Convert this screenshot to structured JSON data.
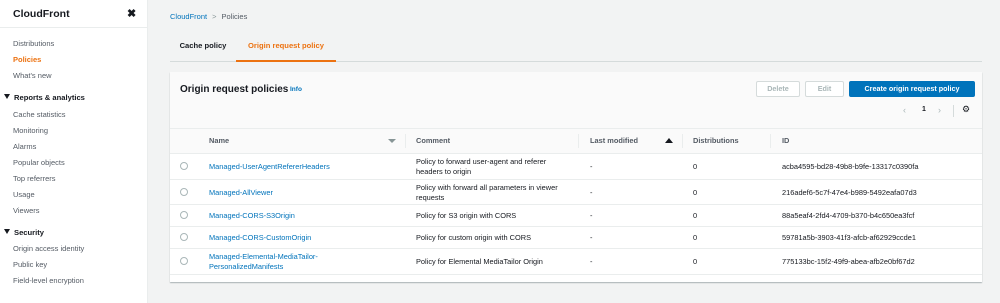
{
  "sidebar": {
    "title": "CloudFront",
    "close_glyph": "✖",
    "items": [
      {
        "label": "Distributions"
      },
      {
        "label": "Policies"
      },
      {
        "label": "What's new"
      }
    ],
    "sections": [
      {
        "label": "Reports & analytics",
        "items": [
          {
            "label": "Cache statistics"
          },
          {
            "label": "Monitoring"
          },
          {
            "label": "Alarms"
          },
          {
            "label": "Popular objects"
          },
          {
            "label": "Top referrers"
          },
          {
            "label": "Usage"
          },
          {
            "label": "Viewers"
          }
        ]
      },
      {
        "label": "Security",
        "items": [
          {
            "label": "Origin access identity"
          },
          {
            "label": "Public key"
          },
          {
            "label": "Field-level encryption"
          }
        ]
      }
    ]
  },
  "breadcrumb": {
    "root": "CloudFront",
    "separator": ">",
    "current": "Policies"
  },
  "tabs": [
    {
      "label": "Cache policy"
    },
    {
      "label": "Origin request policy"
    }
  ],
  "panel": {
    "title": "Origin request policies",
    "info": "Info",
    "delete_label": "Delete",
    "edit_label": "Edit",
    "create_label": "Create origin request policy",
    "pager": {
      "prev": "‹",
      "page": "1",
      "next": "›",
      "settings_glyph": "⚙"
    }
  },
  "table": {
    "columns": [
      "Name",
      "Comment",
      "Last modified",
      "Distributions",
      "ID"
    ],
    "rows": [
      {
        "name": [
          "Managed-UserAgentRefererHeaders"
        ],
        "comment": [
          "Policy to forward user-agent and referer",
          "headers to origin"
        ],
        "modified": "-",
        "distributions": "0",
        "id": "acba4595-bd28-49b8-b9fe-13317c0390fa"
      },
      {
        "name": [
          "Managed-AllViewer"
        ],
        "comment": [
          "Policy with forward all parameters in viewer",
          "requests"
        ],
        "modified": "-",
        "distributions": "0",
        "id": "216adef6-5c7f-47e4-b989-5492eafa07d3"
      },
      {
        "name": [
          "Managed-CORS-S3Origin"
        ],
        "comment": [
          "Policy for S3 origin with CORS"
        ],
        "modified": "-",
        "distributions": "0",
        "id": "88a5eaf4-2fd4-4709-b370-b4c650ea3fcf"
      },
      {
        "name": [
          "Managed-CORS-CustomOrigin"
        ],
        "comment": [
          "Policy for custom origin with CORS"
        ],
        "modified": "-",
        "distributions": "0",
        "id": "59781a5b-3903-41f3-afcb-af62929ccde1"
      },
      {
        "name": [
          "Managed-Elemental-MediaTailor-",
          "PersonalizedManifests"
        ],
        "comment": [
          "Policy for Elemental MediaTailor Origin"
        ],
        "modified": "-",
        "distributions": "0",
        "id": "775133bc-15f2-49f9-abea-afb2e0bf67d2"
      }
    ]
  },
  "colors": {
    "accent": "#ec7211",
    "link": "#0073bb",
    "primary_button": "#0073bb"
  }
}
